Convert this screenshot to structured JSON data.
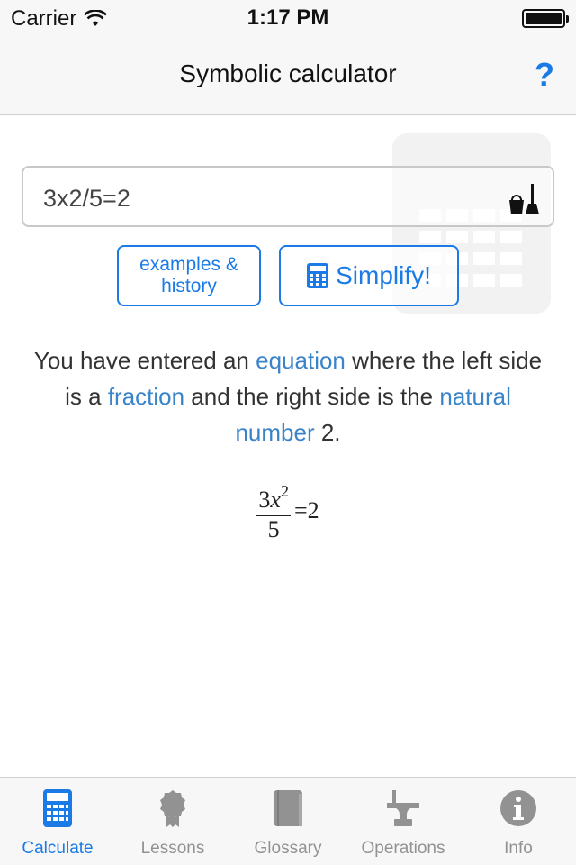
{
  "status_bar": {
    "carrier": "Carrier",
    "time": "1:17 PM",
    "wifi_icon": "wifi-icon",
    "battery_icon": "battery-icon"
  },
  "nav": {
    "title": "Symbolic calculator",
    "help_label": "?"
  },
  "input": {
    "value": "3x2/5=2",
    "clear_icon": "broom-bucket-icon"
  },
  "buttons": {
    "examples_line1": "examples &",
    "examples_line2": "history",
    "simplify_label": "Simplify!",
    "simplify_icon": "calculator-icon"
  },
  "description": {
    "part1": "You have entered an ",
    "link_equation": "equation",
    "part2": " where the left side is a ",
    "link_fraction": "fraction",
    "part3": " and the right side is the ",
    "link_natural_number": "natural number",
    "part4": " 2."
  },
  "formula": {
    "numerator_coef": "3",
    "numerator_var": "x",
    "numerator_exp": "2",
    "denominator": "5",
    "rhs": "=2"
  },
  "tabs": [
    {
      "label": "Calculate",
      "icon": "calculator-icon",
      "active": true
    },
    {
      "label": "Lessons",
      "icon": "award-ribbon-icon",
      "active": false
    },
    {
      "label": "Glossary",
      "icon": "book-icon",
      "active": false
    },
    {
      "label": "Operations",
      "icon": "anvil-icon",
      "active": false
    },
    {
      "label": "Info",
      "icon": "info-icon",
      "active": false
    }
  ],
  "colors": {
    "accent": "#1a7be6",
    "link": "#3a84c9",
    "inactive_tab": "#929292"
  }
}
